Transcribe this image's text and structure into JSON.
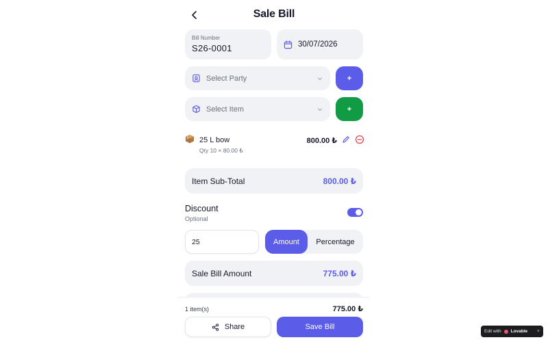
{
  "header": {
    "title": "Sale Bill"
  },
  "bill": {
    "number_label": "Bill Number",
    "number": "S26-0001",
    "date": "30/07/2026"
  },
  "party": {
    "placeholder": "Select Party",
    "add_label": "+"
  },
  "item_select": {
    "placeholder": "Select Item",
    "add_label": "+"
  },
  "line_items": [
    {
      "name": "25 L bow",
      "qty_text": "Qty 10 × 80.00 ₺",
      "amount": "800.00 ₺"
    }
  ],
  "subtotal": {
    "label": "Item Sub-Total",
    "value": "800.00 ₺"
  },
  "discount": {
    "title": "Discount",
    "subtitle": "Optional",
    "enabled": true,
    "value": "25",
    "mode_amount": "Amount",
    "mode_percentage": "Percentage",
    "selected_mode": "Amount"
  },
  "sale_amount": {
    "label": "Sale Bill Amount",
    "value": "775.00 ₺"
  },
  "footer": {
    "item_count": "1 item(s)",
    "total": "775.00 ₺",
    "share_label": "Share",
    "save_label": "Save Bill"
  },
  "lovable_badge": {
    "prefix": "Edit with",
    "brand": "Lovable",
    "close": "×"
  },
  "colors": {
    "accent": "#5b5ce8",
    "green": "#119b45",
    "danger": "#e5484d",
    "surface": "#f1f2f5"
  },
  "icons": {
    "back": "chevron-left-icon",
    "calendar": "calendar-icon",
    "party": "contact-icon",
    "item": "box-icon",
    "edit": "pencil-icon",
    "remove": "minus-circle-icon",
    "share": "share-icon"
  }
}
